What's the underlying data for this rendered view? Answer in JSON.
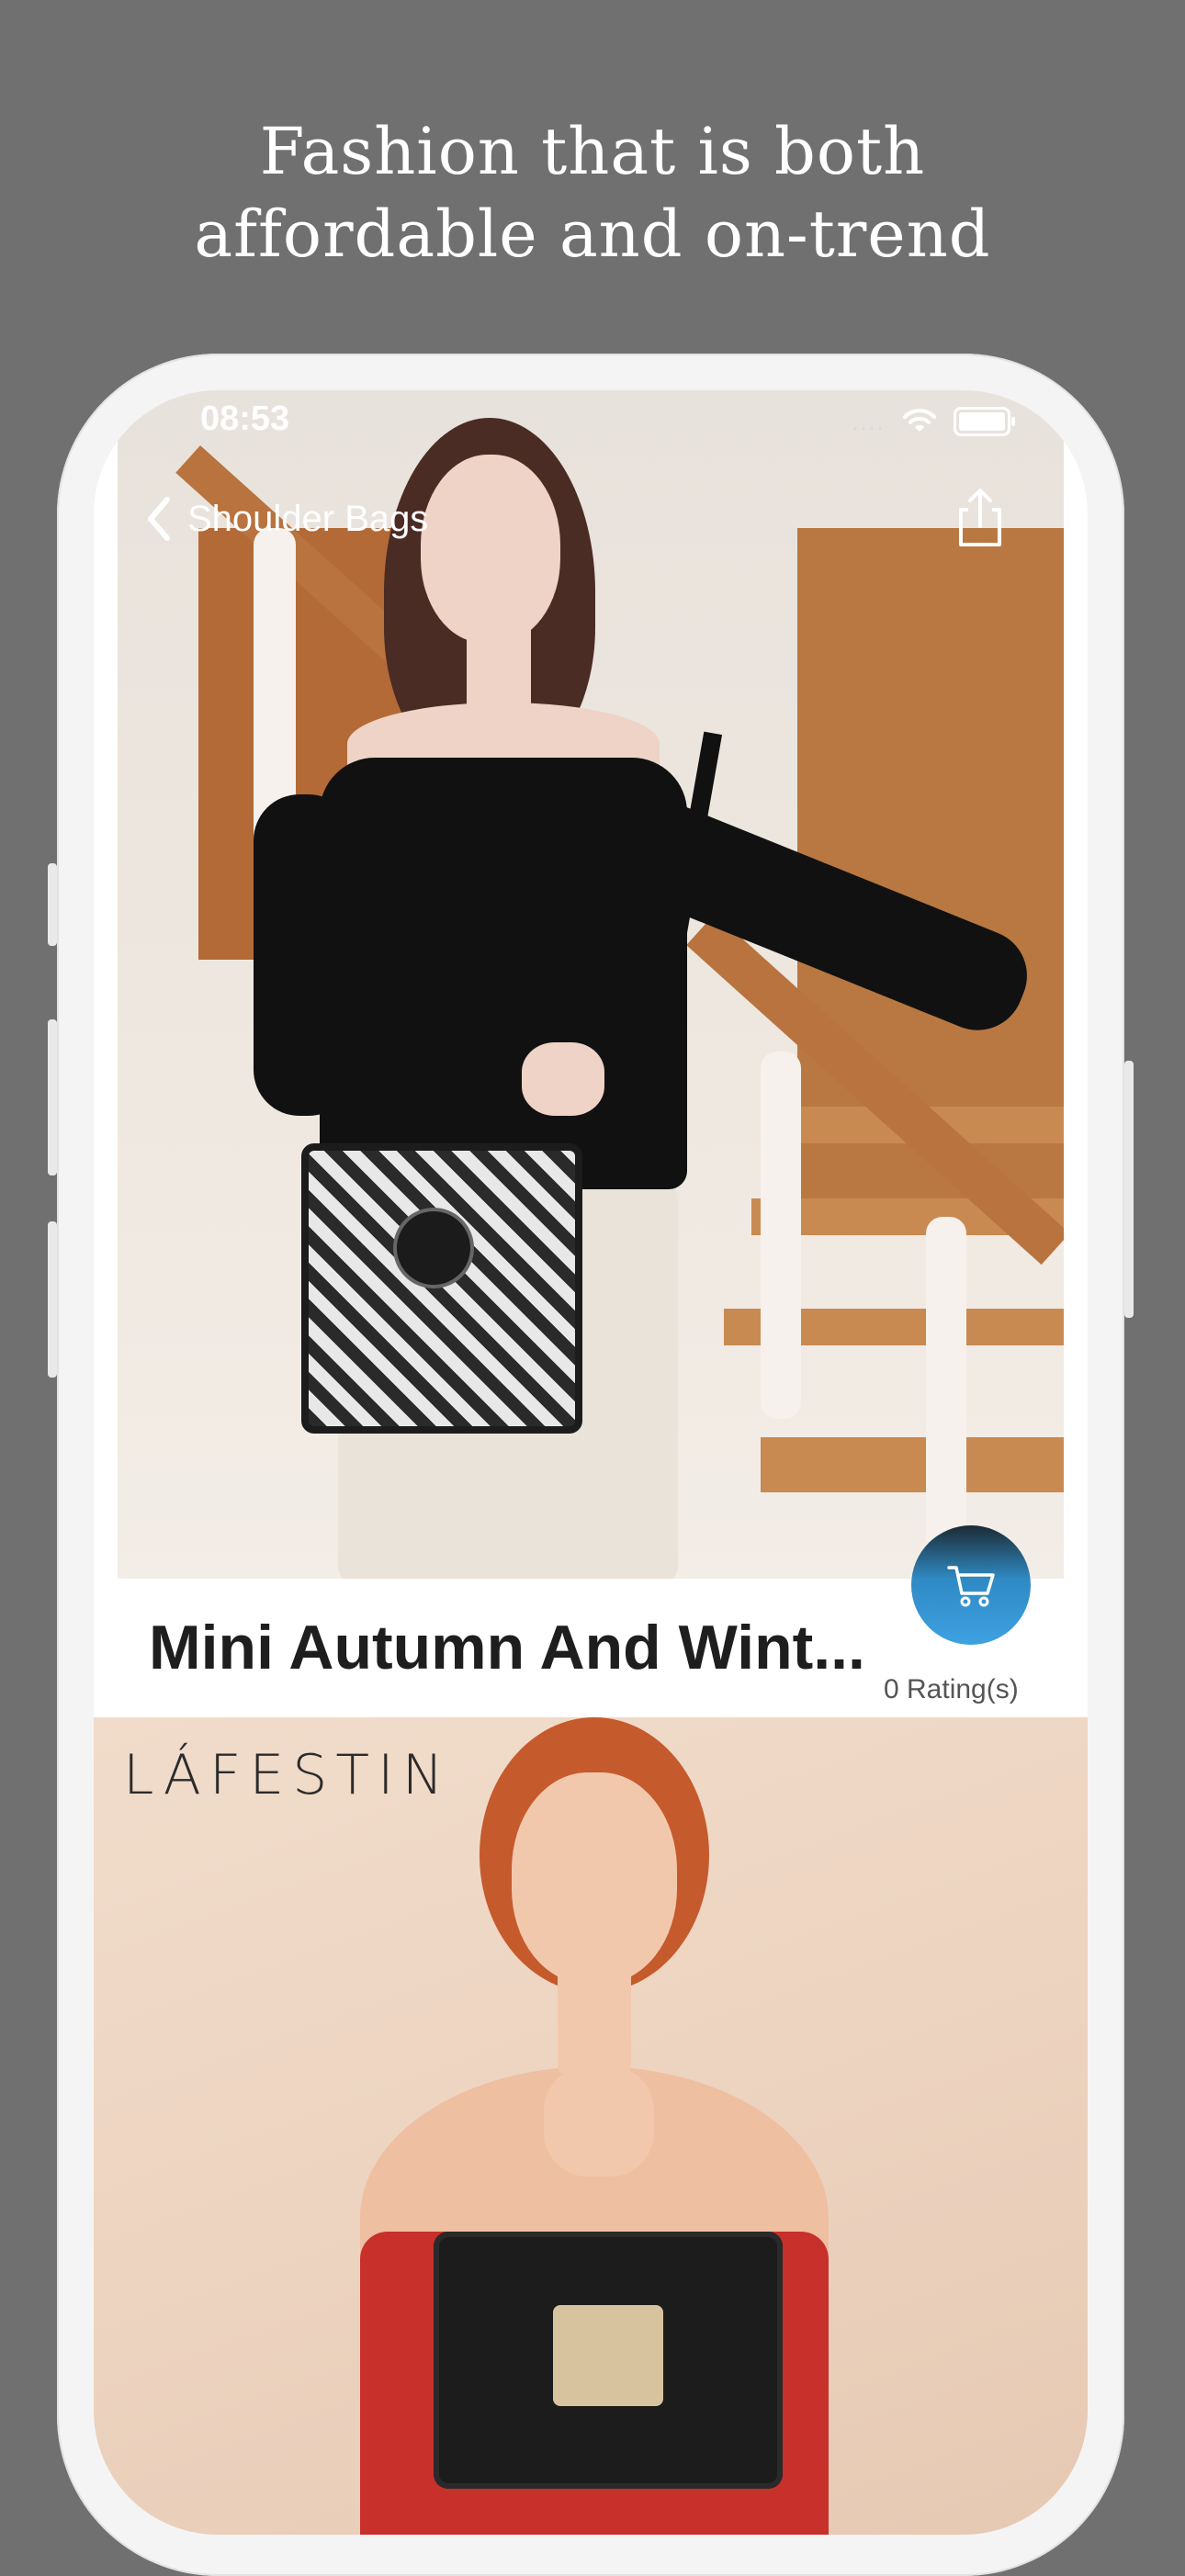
{
  "promo": {
    "headline_line1": "Fashion that is both",
    "headline_line2": "affordable and on-trend"
  },
  "status_bar": {
    "time": "08:53",
    "signal": "....",
    "icons": [
      "wifi-icon",
      "battery-icon"
    ]
  },
  "nav": {
    "back_label": "Shoulder Bags",
    "back_icon": "chevron-left-icon",
    "share_icon": "share-icon"
  },
  "product": {
    "title": "Mini Autumn And Wint...",
    "rating": "0 Rating(s)",
    "cart_icon": "cart-icon"
  },
  "next_product": {
    "brand": "LÁFESTIN"
  },
  "colors": {
    "background": "#707070",
    "phone_frame": "#f4f4f4",
    "accent": "#3ea1e2",
    "title_text": "#1e1e1e"
  }
}
